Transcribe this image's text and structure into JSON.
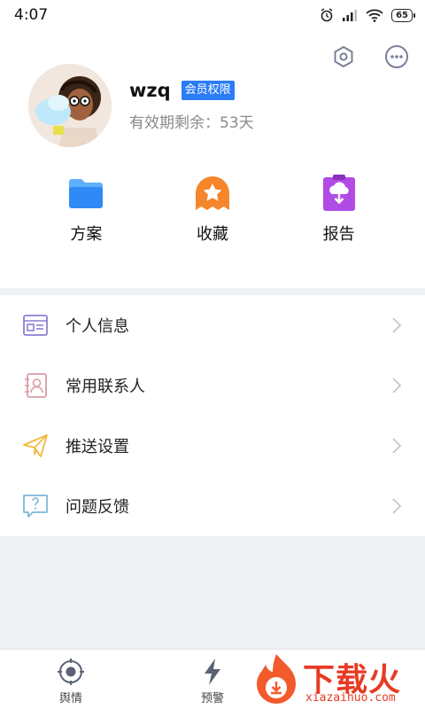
{
  "status_bar": {
    "time": "4:07",
    "battery": "65"
  },
  "top_actions": {
    "settings_icon": "hexagon-settings-icon",
    "message_icon": "chat-bubble-icon"
  },
  "profile": {
    "username": "wzq",
    "badge": "会员权限",
    "validity": "有效期剩余：53天"
  },
  "shortcuts": [
    {
      "label": "方案",
      "icon": "folder-icon",
      "color": "#2f8af5"
    },
    {
      "label": "收藏",
      "icon": "star-ribbon-icon",
      "color": "#f5862b"
    },
    {
      "label": "报告",
      "icon": "cloud-download-icon",
      "color": "#b14be6"
    }
  ],
  "menu": [
    {
      "label": "个人信息",
      "icon": "id-card-icon"
    },
    {
      "label": "常用联系人",
      "icon": "contact-book-icon"
    },
    {
      "label": "推送设置",
      "icon": "paper-plane-icon"
    },
    {
      "label": "问题反馈",
      "icon": "feedback-bubble-icon"
    }
  ],
  "bottom_nav": [
    {
      "label": "舆情",
      "icon": "target-icon"
    },
    {
      "label": "预警",
      "icon": "lightning-icon"
    }
  ],
  "watermark": {
    "text": "下载火",
    "url": "xiazaihuo.com"
  }
}
